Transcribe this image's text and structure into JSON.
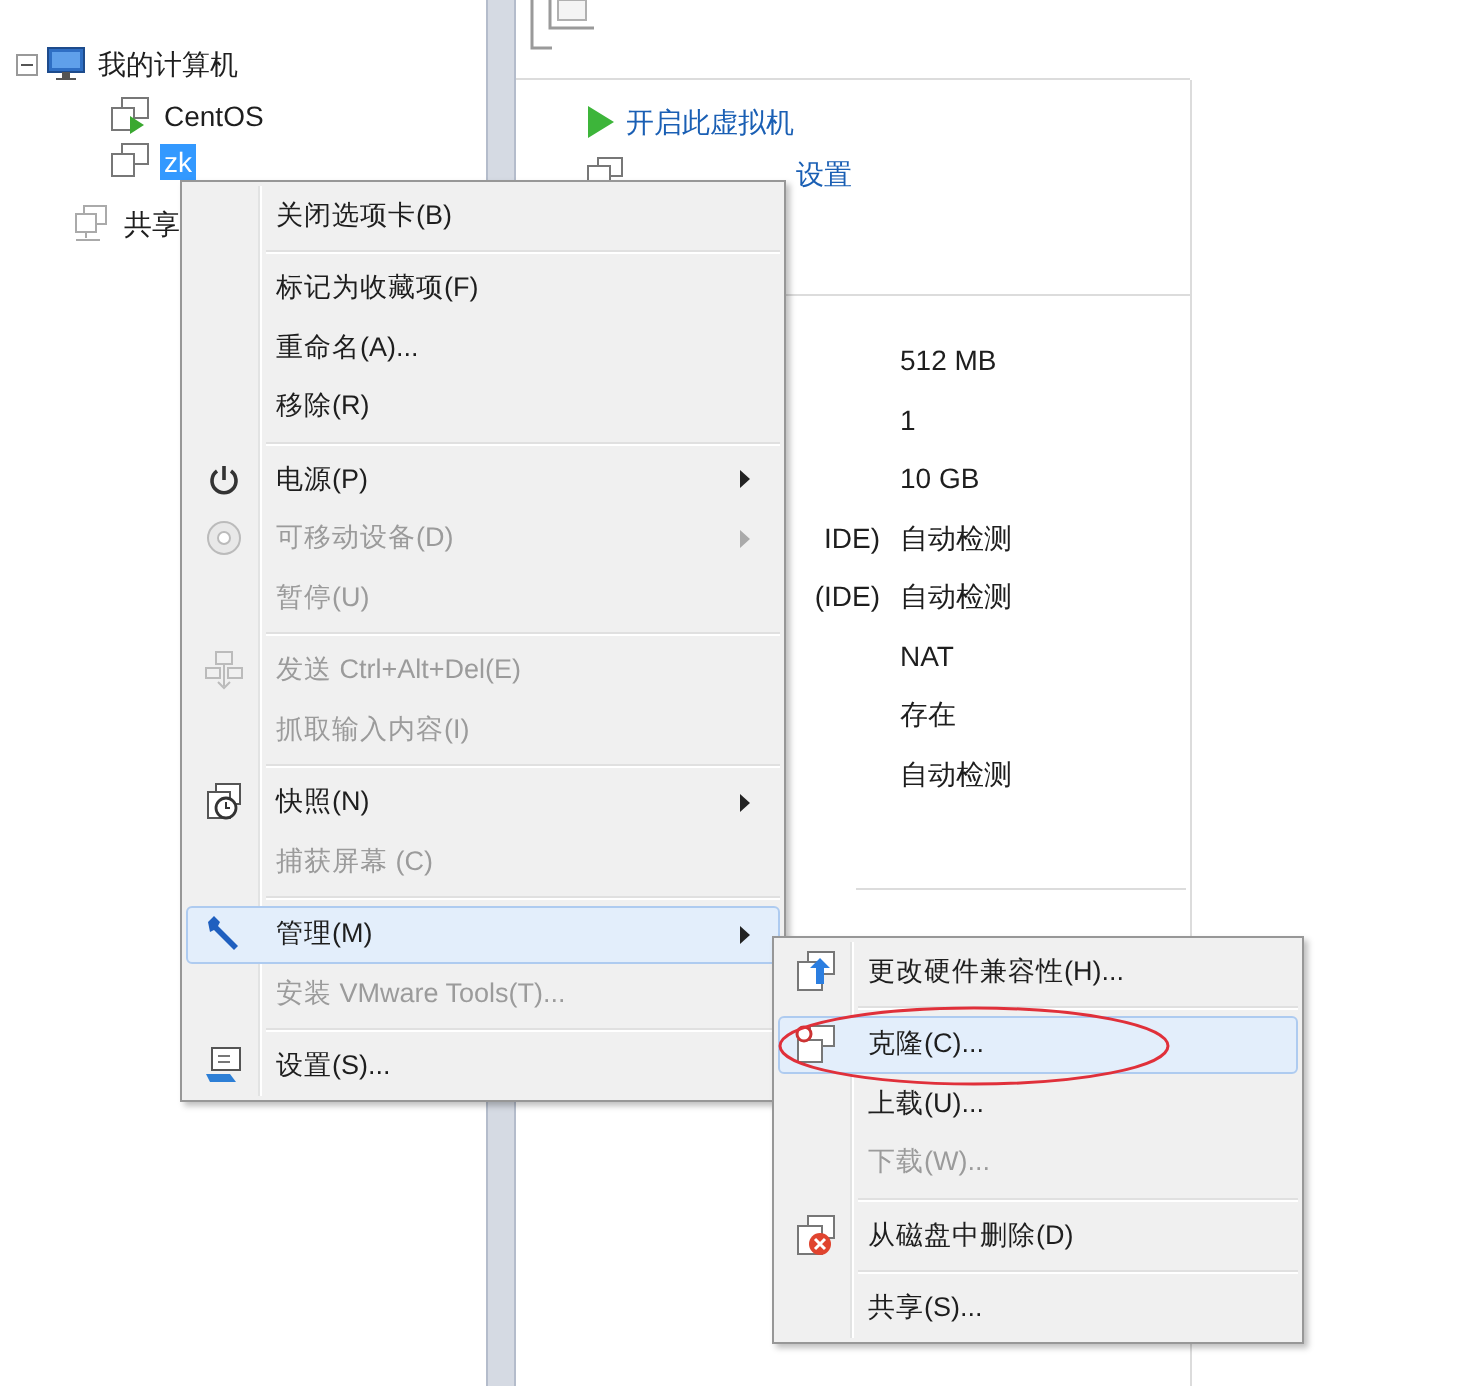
{
  "tree": [
    {
      "label": "我的计算机",
      "kind": "computer",
      "expanded": true,
      "selected": false,
      "children": [
        {
          "label": "CentOS",
          "kind": "vm",
          "running": true,
          "selected": false
        },
        {
          "label": "zk",
          "kind": "vm",
          "running": false,
          "selected": true
        }
      ]
    },
    {
      "label": "共享",
      "kind": "shared",
      "selected": false
    }
  ],
  "vm_actions": [
    {
      "label": "开启此虚拟机"
    },
    {
      "label": "设置"
    }
  ],
  "details": [
    {
      "value": "512 MB"
    },
    {
      "value": "1"
    },
    {
      "value": "10 GB"
    },
    {
      "label": "IDE)",
      "value": "自动检测"
    },
    {
      "label": "(IDE)",
      "value": "自动检测"
    },
    {
      "value": "NAT"
    },
    {
      "value": "存在"
    },
    {
      "value": "自动检测"
    }
  ],
  "context_menu": {
    "items": [
      {
        "kind": "item",
        "label": "关闭选项卡(B)",
        "disabled": false,
        "highlighted": false,
        "submenu": false
      },
      {
        "kind": "separator"
      },
      {
        "kind": "item",
        "label": "标记为收藏项(F)",
        "disabled": false,
        "highlighted": false,
        "submenu": false
      },
      {
        "kind": "item",
        "label": "重命名(A)...",
        "disabled": false,
        "highlighted": false,
        "submenu": false
      },
      {
        "kind": "item",
        "label": "移除(R)",
        "disabled": false,
        "highlighted": false,
        "submenu": false
      },
      {
        "kind": "separator"
      },
      {
        "kind": "item",
        "label": "电源(P)",
        "disabled": false,
        "highlighted": false,
        "submenu": true
      },
      {
        "kind": "item",
        "label": "可移动设备(D)",
        "disabled": true,
        "highlighted": false,
        "submenu": true
      },
      {
        "kind": "item",
        "label": "暂停(U)",
        "disabled": true,
        "highlighted": false,
        "submenu": false
      },
      {
        "kind": "separator"
      },
      {
        "kind": "item",
        "label": "发送 Ctrl+Alt+Del(E)",
        "disabled": true,
        "highlighted": false,
        "submenu": false
      },
      {
        "kind": "item",
        "label": "抓取输入内容(I)",
        "disabled": true,
        "highlighted": false,
        "submenu": false
      },
      {
        "kind": "separator"
      },
      {
        "kind": "item",
        "label": "快照(N)",
        "disabled": false,
        "highlighted": false,
        "submenu": true
      },
      {
        "kind": "item",
        "label": "捕获屏幕 (C)",
        "disabled": true,
        "highlighted": false,
        "submenu": false
      },
      {
        "kind": "separator"
      },
      {
        "kind": "item",
        "label": "管理(M)",
        "disabled": false,
        "highlighted": true,
        "submenu": true
      },
      {
        "kind": "item",
        "label": "安装 VMware Tools(T)...",
        "disabled": true,
        "highlighted": false,
        "submenu": false
      },
      {
        "kind": "separator"
      },
      {
        "kind": "item",
        "label": "设置(S)...",
        "disabled": false,
        "highlighted": false,
        "submenu": false
      }
    ]
  },
  "submenu": {
    "items": [
      {
        "kind": "item",
        "label": "更改硬件兼容性(H)...",
        "disabled": false,
        "highlighted": false,
        "circled": false
      },
      {
        "kind": "separator"
      },
      {
        "kind": "item",
        "label": "克隆(C)...",
        "disabled": false,
        "highlighted": true,
        "circled": true
      },
      {
        "kind": "item",
        "label": "上载(U)...",
        "disabled": false,
        "highlighted": false,
        "circled": false
      },
      {
        "kind": "item",
        "label": "下载(W)...",
        "disabled": true,
        "highlighted": false,
        "circled": false
      },
      {
        "kind": "separator"
      },
      {
        "kind": "item",
        "label": "从磁盘中删除(D)",
        "disabled": false,
        "highlighted": false,
        "circled": false
      },
      {
        "kind": "separator"
      },
      {
        "kind": "item",
        "label": "共享(S)...",
        "disabled": false,
        "highlighted": false,
        "circled": false
      }
    ]
  }
}
